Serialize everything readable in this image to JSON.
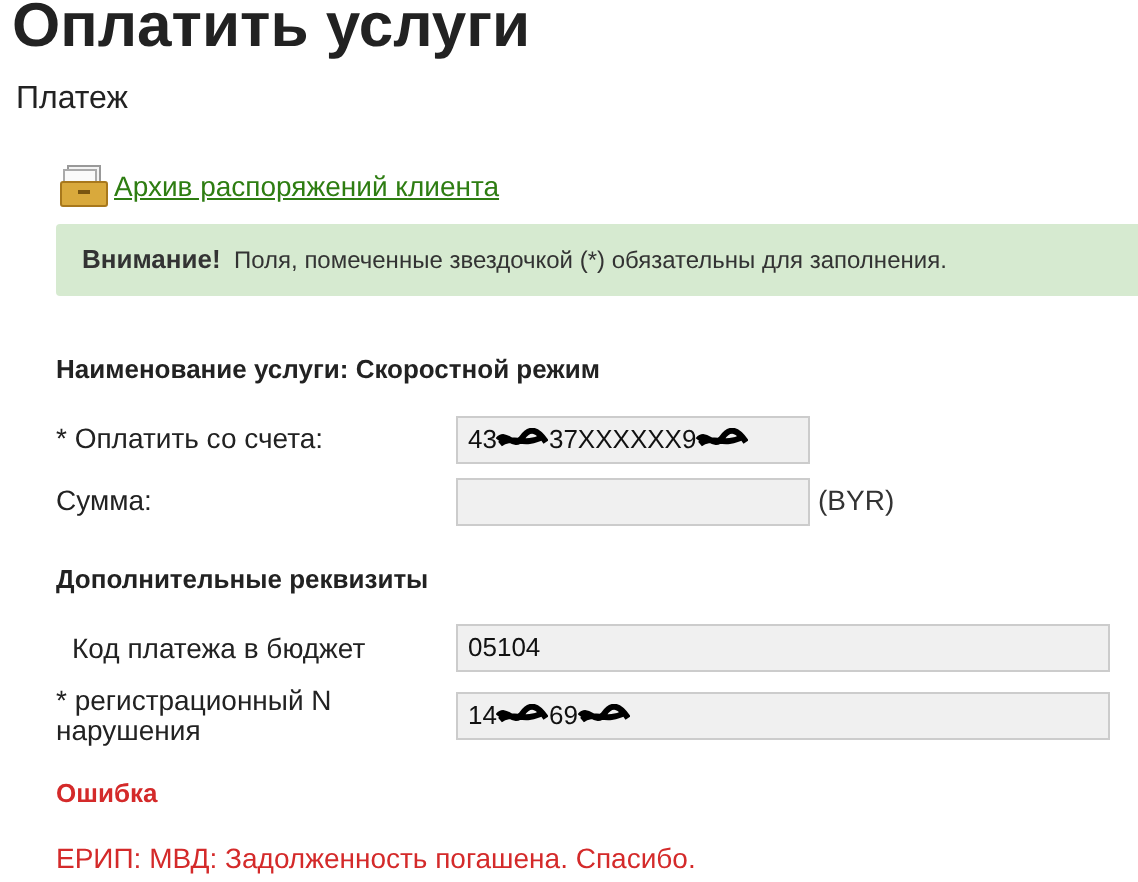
{
  "title": "Оплатить услуги",
  "subtitle": "Платеж",
  "archive_link": "Архив распоряжений клиента",
  "notice": {
    "label": "Внимание!",
    "text": "Поля, помеченные звездочкой (*) обязательны для заполнения."
  },
  "service": {
    "label": "Наименование услуги:",
    "value": "Скоростной режим"
  },
  "fields": [
    {
      "label": "* Оплатить со счета:",
      "value_parts": [
        "43",
        "37XXXXXX9"
      ],
      "redacted": true,
      "wide": false
    },
    {
      "label": "Сумма:",
      "wide": false,
      "suffix": "(BYR)"
    }
  ],
  "extra_heading": "Дополнительные реквизиты",
  "extra_fields": [
    {
      "label": "Код платежа в бюджет",
      "value_parts": [
        "05104"
      ],
      "redacted": false,
      "wide": true
    },
    {
      "label": "* регистрационный N нарушения",
      "value_parts": [
        "14",
        "69"
      ],
      "redacted": true,
      "wide": true
    }
  ],
  "error": {
    "title": "Ошибка",
    "message": "ЕРИП: МВД: Задолженность погашена. Спасибо."
  }
}
